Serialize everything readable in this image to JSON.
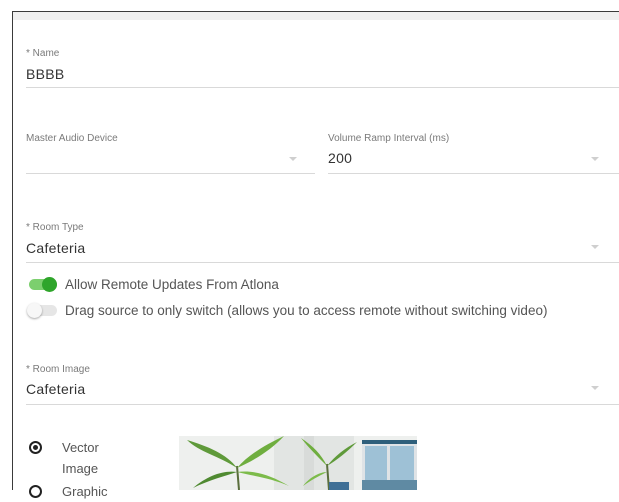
{
  "form": {
    "name": {
      "label": "* Name",
      "value": "BBBB"
    },
    "master_audio_device": {
      "label": "Master Audio Device",
      "value": ""
    },
    "volume_ramp_interval": {
      "label": "Volume Ramp Interval (ms)",
      "value": "200"
    },
    "room_type": {
      "label": "* Room Type",
      "value": "Cafeteria"
    },
    "toggles": [
      {
        "label": "Allow Remote Updates From Atlona",
        "checked": true
      },
      {
        "label": "Drag source to only switch (allows you to access remote without switching video)",
        "checked": false
      }
    ],
    "room_image": {
      "label": "* Room Image",
      "value": "Cafeteria"
    },
    "image_type_options": [
      {
        "label": "Vector Image",
        "selected": true
      },
      {
        "label": "Graphic",
        "selected": false
      }
    ]
  },
  "colors": {
    "toggle_on": "#2fa52b",
    "toggle_on_track": "#7ccf6e",
    "label_gray": "#7a7a7a",
    "underline": "#d9d9d9"
  },
  "icons": {
    "dropdown": "caret-down-icon",
    "radio": "radio-icon"
  }
}
